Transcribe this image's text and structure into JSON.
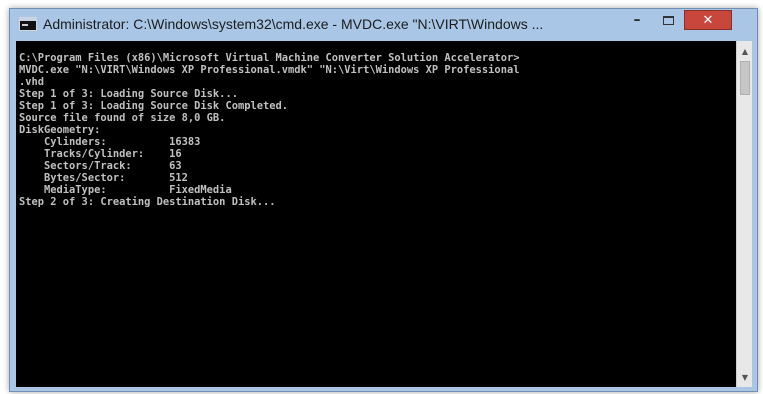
{
  "window": {
    "title": "Administrator: C:\\Windows\\system32\\cmd.exe - MVDC.exe  \"N:\\VIRT\\Windows ...",
    "icon": "cmd-icon",
    "controls": {
      "minimize": "–",
      "close": "✕"
    }
  },
  "console": {
    "lines": [
      "C:\\Program Files (x86)\\Microsoft Virtual Machine Converter Solution Accelerator>",
      "MVDC.exe \"N:\\VIRT\\Windows XP Professional.vmdk\" \"N:\\Virt\\Windows XP Professional",
      ".vhd",
      "Step 1 of 3: Loading Source Disk...",
      "Step 1 of 3: Loading Source Disk Completed.",
      "Source file found of size 8,0 GB.",
      "DiskGeometry:",
      "    Cylinders:          16383",
      "    Tracks/Cylinder:    16",
      "    Sectors/Track:      63",
      "    Bytes/Sector:       512",
      "    MediaType:          FixedMedia",
      "Step 2 of 3: Creating Destination Disk..."
    ]
  },
  "scrollbar": {
    "up": "▲",
    "down": "▼"
  }
}
